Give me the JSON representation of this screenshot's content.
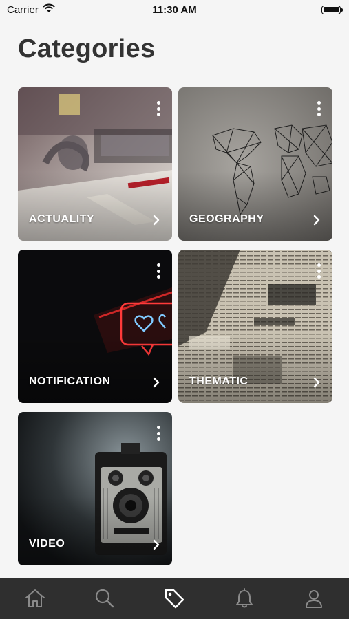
{
  "status_bar": {
    "carrier": "Carrier",
    "time": "11:30 AM"
  },
  "page": {
    "title": "Categories"
  },
  "categories": [
    {
      "label": "ACTUALITY",
      "image": "desk-with-headphones-and-laptop"
    },
    {
      "label": "GEOGRAPHY",
      "image": "geometric-world-map-on-wall"
    },
    {
      "label": "NOTIFICATION",
      "image": "neon-like-notification-sign"
    },
    {
      "label": "THEMATIC",
      "image": "old-newspaper-page"
    },
    {
      "label": "VIDEO",
      "image": "vintage-spartus-camera"
    }
  ],
  "tab_bar": {
    "tabs": [
      {
        "icon": "home-icon",
        "active": false
      },
      {
        "icon": "search-icon",
        "active": false
      },
      {
        "icon": "tag-icon",
        "active": true
      },
      {
        "icon": "bell-icon",
        "active": false
      },
      {
        "icon": "profile-icon",
        "active": false
      }
    ],
    "background": "#2f2f2f",
    "active_color": "#ffffff",
    "inactive_color": "#8a8a8a"
  }
}
